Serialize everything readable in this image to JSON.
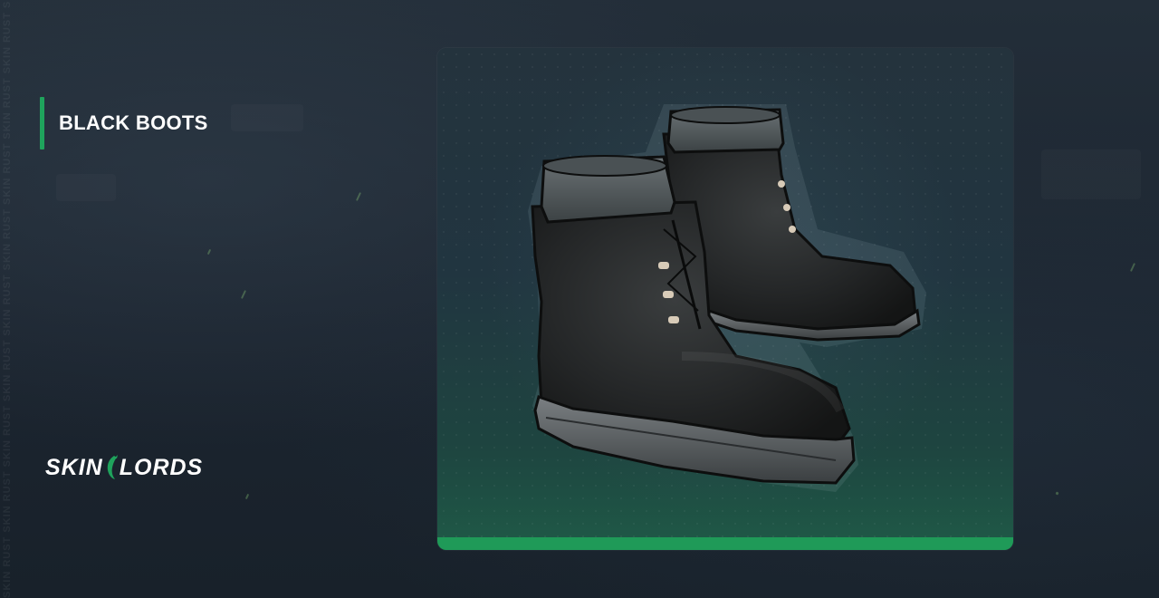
{
  "item": {
    "name": "BLACK BOOTS",
    "icon": "black-boots-image"
  },
  "brand": {
    "logo_left": "SKIN",
    "logo_right": "LORDS",
    "side_watermark": "SKIN RUST SKIN RUST SKIN RUST SKIN RUST SKIN RUST SKIN RUST SKIN RUST SKIN RUST SKIN RUST SKIN"
  },
  "colors": {
    "accent": "#1fa35c",
    "background": "#1d2731",
    "card_bottom": "#1f9a58"
  }
}
